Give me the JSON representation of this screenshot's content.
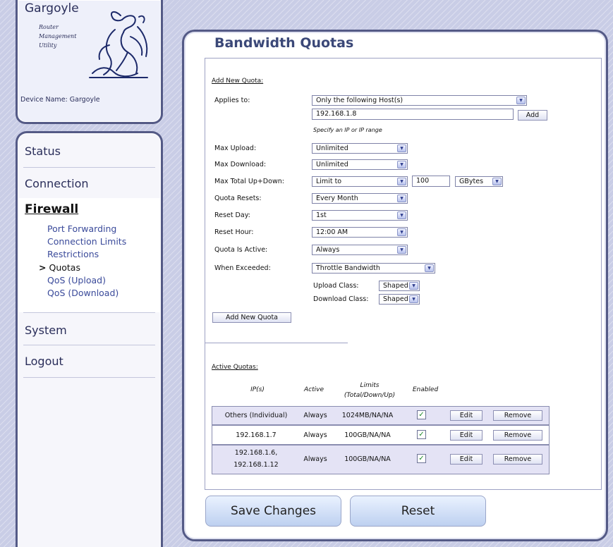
{
  "logo": {
    "title": "Gargoyle",
    "subtitle_1": "Router",
    "subtitle_2": "Management",
    "subtitle_3": "Utility",
    "device_name": "Device Name: Gargoyle"
  },
  "nav": {
    "status": "Status",
    "connection": "Connection",
    "firewall": "Firewall",
    "firewall_items": [
      "Port Forwarding",
      "Connection Limits",
      "Restrictions",
      "Quotas",
      "QoS (Upload)",
      "QoS (Download)"
    ],
    "active_marker": ">",
    "system": "System",
    "logout": "Logout"
  },
  "page": {
    "title": "Bandwidth Quotas",
    "add_section_title": "Add New Quota:",
    "active_section_title": "Active Quotas:"
  },
  "form": {
    "applies_to": {
      "label": "Applies to:",
      "value": "Only the following Host(s)"
    },
    "host_input": {
      "value": "192.168.1.8",
      "add_label": "Add",
      "hint": "Specify an IP or IP range"
    },
    "max_upload": {
      "label": "Max Upload:",
      "value": "Unlimited"
    },
    "max_download": {
      "label": "Max Download:",
      "value": "Unlimited"
    },
    "max_total": {
      "label": "Max Total Up+Down:",
      "value": "Limit to",
      "amount": "100",
      "unit": "GBytes"
    },
    "quota_resets": {
      "label": "Quota Resets:",
      "value": "Every Month"
    },
    "reset_day": {
      "label": "Reset Day:",
      "value": "1st"
    },
    "reset_hour": {
      "label": "Reset Hour:",
      "value": "12:00 AM"
    },
    "quota_active": {
      "label": "Quota Is Active:",
      "value": "Always"
    },
    "when_exceeded": {
      "label": "When Exceeded:",
      "value": "Throttle Bandwidth"
    },
    "upload_class": {
      "label": "Upload Class:",
      "value": "Shaped"
    },
    "download_class": {
      "label": "Download Class:",
      "value": "Shaped"
    },
    "add_quota_label": "Add New Quota"
  },
  "quota_table": {
    "headers": {
      "ips": "IP(s)",
      "active": "Active",
      "limits_1": "Limits",
      "limits_2": "(Total/Down/Up)",
      "enabled": "Enabled"
    },
    "rows": [
      {
        "ip": "Others (Individual)",
        "active": "Always",
        "limits": "1024MB/NA/NA",
        "enabled_mark": "✓",
        "edit": "Edit",
        "remove": "Remove"
      },
      {
        "ip": "192.168.1.7",
        "active": "Always",
        "limits": "100GB/NA/NA",
        "enabled_mark": "✓",
        "edit": "Edit",
        "remove": "Remove"
      },
      {
        "ip": "192.168.1.6,",
        "ip_line2": "192.168.1.12",
        "active": "Always",
        "limits": "100GB/NA/NA",
        "enabled_mark": "✓",
        "edit": "Edit",
        "remove": "Remove"
      }
    ]
  },
  "actions": {
    "save": "Save Changes",
    "reset": "Reset"
  },
  "icons": {
    "dropdown": "chevron-down-icon",
    "check": "check-icon",
    "logo": "gargoyle-icon"
  },
  "colors": {
    "accent": "#3b4878",
    "frame": "#545a86",
    "row_shade": "#e4e3f5",
    "check": "#1f8a2a"
  }
}
